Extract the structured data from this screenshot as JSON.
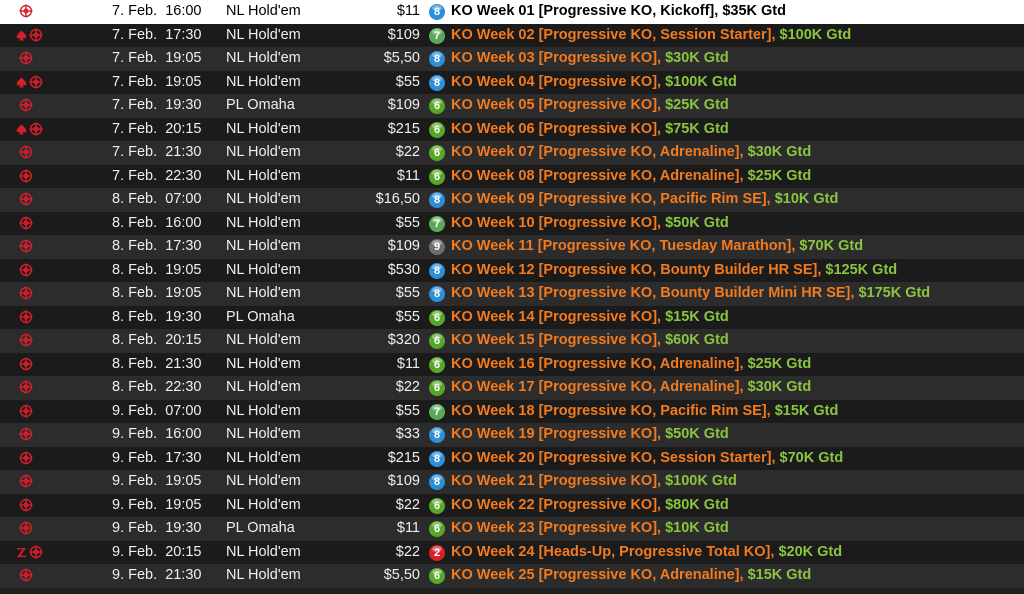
{
  "colors": {
    "tournament_name": "#f27a1f",
    "guarantee": "#8bc53f",
    "icon_red": "#d81e2a",
    "level": {
      "2": "#d92027",
      "6": "#58a62a",
      "7": "#5aa85a",
      "8": "#2e8fd6",
      "9": "#6e6e6e"
    }
  },
  "rows": [
    {
      "date": "7. Feb.",
      "time": "16:00",
      "game": "NL Hold'em",
      "buyin": "$11",
      "level": "8",
      "name": "KO Week 01 [Progressive KO, Kickoff]",
      "sep": ", ",
      "gtd": "$35K Gtd",
      "badge": "",
      "selected": true
    },
    {
      "date": "7. Feb.",
      "time": "17:30",
      "game": "NL Hold'em",
      "buyin": "$109",
      "level": "7",
      "name": "KO Week 02 [Progressive KO, Session Starter]",
      "sep": ", ",
      "gtd": "$100K Gtd",
      "badge": "spade"
    },
    {
      "date": "7. Feb.",
      "time": "19:05",
      "game": "NL Hold'em",
      "buyin": "$5,50",
      "level": "8",
      "name": "KO Week 03 [Progressive KO]",
      "sep": ", ",
      "gtd": "$30K Gtd",
      "badge": ""
    },
    {
      "date": "7. Feb.",
      "time": "19:05",
      "game": "NL Hold'em",
      "buyin": "$55",
      "level": "8",
      "name": "KO Week 04 [Progressive KO]",
      "sep": ", ",
      "gtd": "$100K Gtd",
      "badge": "spade"
    },
    {
      "date": "7. Feb.",
      "time": "19:30",
      "game": "PL Omaha",
      "buyin": "$109",
      "level": "6",
      "name": "KO Week 05 [Progressive KO]",
      "sep": ", ",
      "gtd": "$25K Gtd",
      "badge": ""
    },
    {
      "date": "7. Feb.",
      "time": "20:15",
      "game": "NL Hold'em",
      "buyin": "$215",
      "level": "6",
      "name": "KO Week 06 [Progressive KO]",
      "sep": ", ",
      "gtd": "$75K Gtd",
      "badge": "spade"
    },
    {
      "date": "7. Feb.",
      "time": "21:30",
      "game": "NL Hold'em",
      "buyin": "$22",
      "level": "6",
      "name": "KO Week 07 [Progressive KO, Adrenaline]",
      "sep": ", ",
      "gtd": "$30K Gtd",
      "badge": ""
    },
    {
      "date": "7. Feb.",
      "time": "22:30",
      "game": "NL Hold'em",
      "buyin": "$11",
      "level": "6",
      "name": "KO Week 08 [Progressive KO, Adrenaline]",
      "sep": ", ",
      "gtd": "$25K Gtd",
      "badge": ""
    },
    {
      "date": "8. Feb.",
      "time": "07:00",
      "game": "NL Hold'em",
      "buyin": "$16,50",
      "level": "8",
      "name": "KO Week 09 [Progressive KO, Pacific Rim SE]",
      "sep": ", ",
      "gtd": "$10K Gtd",
      "badge": ""
    },
    {
      "date": "8. Feb.",
      "time": "16:00",
      "game": "NL Hold'em",
      "buyin": "$55",
      "level": "7",
      "name": "KO Week 10 [Progressive KO]",
      "sep": ", ",
      "gtd": "$50K Gtd",
      "badge": ""
    },
    {
      "date": "8. Feb.",
      "time": "17:30",
      "game": "NL Hold'em",
      "buyin": "$109",
      "level": "9",
      "name": "KO Week 11 [Progressive KO, Tuesday Marathon]",
      "sep": ", ",
      "gtd": "$70K Gtd",
      "badge": ""
    },
    {
      "date": "8. Feb.",
      "time": "19:05",
      "game": "NL Hold'em",
      "buyin": "$530",
      "level": "8",
      "name": "KO Week 12 [Progressive KO, Bounty Builder HR SE]",
      "sep": ", ",
      "gtd": "$125K Gtd",
      "badge": ""
    },
    {
      "date": "8. Feb.",
      "time": "19:05",
      "game": "NL Hold'em",
      "buyin": "$55",
      "level": "8",
      "name": "KO Week 13 [Progressive KO, Bounty Builder Mini HR SE]",
      "sep": ", ",
      "gtd": "$175K Gtd",
      "badge": ""
    },
    {
      "date": "8. Feb.",
      "time": "19:30",
      "game": "PL Omaha",
      "buyin": "$55",
      "level": "6",
      "name": "KO Week 14 [Progressive KO]",
      "sep": ", ",
      "gtd": "$15K Gtd",
      "badge": ""
    },
    {
      "date": "8. Feb.",
      "time": "20:15",
      "game": "NL Hold'em",
      "buyin": "$320",
      "level": "6",
      "name": "KO Week 15 [Progressive KO]",
      "sep": ", ",
      "gtd": "$60K Gtd",
      "badge": ""
    },
    {
      "date": "8. Feb.",
      "time": "21:30",
      "game": "NL Hold'em",
      "buyin": "$11",
      "level": "6",
      "name": "KO Week 16 [Progressive KO, Adrenaline]",
      "sep": ", ",
      "gtd": "$25K Gtd",
      "badge": ""
    },
    {
      "date": "8. Feb.",
      "time": "22:30",
      "game": "NL Hold'em",
      "buyin": "$22",
      "level": "6",
      "name": "KO Week 17 [Progressive KO, Adrenaline]",
      "sep": ", ",
      "gtd": "$30K Gtd",
      "badge": ""
    },
    {
      "date": "9. Feb.",
      "time": "07:00",
      "game": "NL Hold'em",
      "buyin": "$55",
      "level": "7",
      "name": "KO Week 18 [Progressive KO, Pacific Rim SE]",
      "sep": ", ",
      "gtd": "$15K Gtd",
      "badge": ""
    },
    {
      "date": "9. Feb.",
      "time": "16:00",
      "game": "NL Hold'em",
      "buyin": "$33",
      "level": "8",
      "name": "KO Week 19 [Progressive KO]",
      "sep": ", ",
      "gtd": "$50K Gtd",
      "badge": ""
    },
    {
      "date": "9. Feb.",
      "time": "17:30",
      "game": "NL Hold'em",
      "buyin": "$215",
      "level": "8",
      "name": "KO Week 20 [Progressive KO, Session Starter]",
      "sep": ", ",
      "gtd": "$70K Gtd",
      "badge": ""
    },
    {
      "date": "9. Feb.",
      "time": "19:05",
      "game": "NL Hold'em",
      "buyin": "$109",
      "level": "8",
      "name": "KO Week 21 [Progressive KO]",
      "sep": ", ",
      "gtd": "$100K Gtd",
      "badge": ""
    },
    {
      "date": "9. Feb.",
      "time": "19:05",
      "game": "NL Hold'em",
      "buyin": "$22",
      "level": "6",
      "name": "KO Week 22 [Progressive KO]",
      "sep": ", ",
      "gtd": "$80K Gtd",
      "badge": ""
    },
    {
      "date": "9. Feb.",
      "time": "19:30",
      "game": "PL Omaha",
      "buyin": "$11",
      "level": "6",
      "name": "KO Week 23 [Progressive KO]",
      "sep": ", ",
      "gtd": "$10K Gtd",
      "badge": ""
    },
    {
      "date": "9. Feb.",
      "time": "20:15",
      "game": "NL Hold'em",
      "buyin": "$22",
      "level": "2",
      "name": "KO Week 24 [Heads-Up, Progressive Total KO]",
      "sep": ", ",
      "gtd": "$20K Gtd",
      "badge": "z"
    },
    {
      "date": "9. Feb.",
      "time": "21:30",
      "game": "NL Hold'em",
      "buyin": "$5,50",
      "level": "6",
      "name": "KO Week 25 [Progressive KO, Adrenaline]",
      "sep": ", ",
      "gtd": "$15K Gtd",
      "badge": ""
    }
  ]
}
